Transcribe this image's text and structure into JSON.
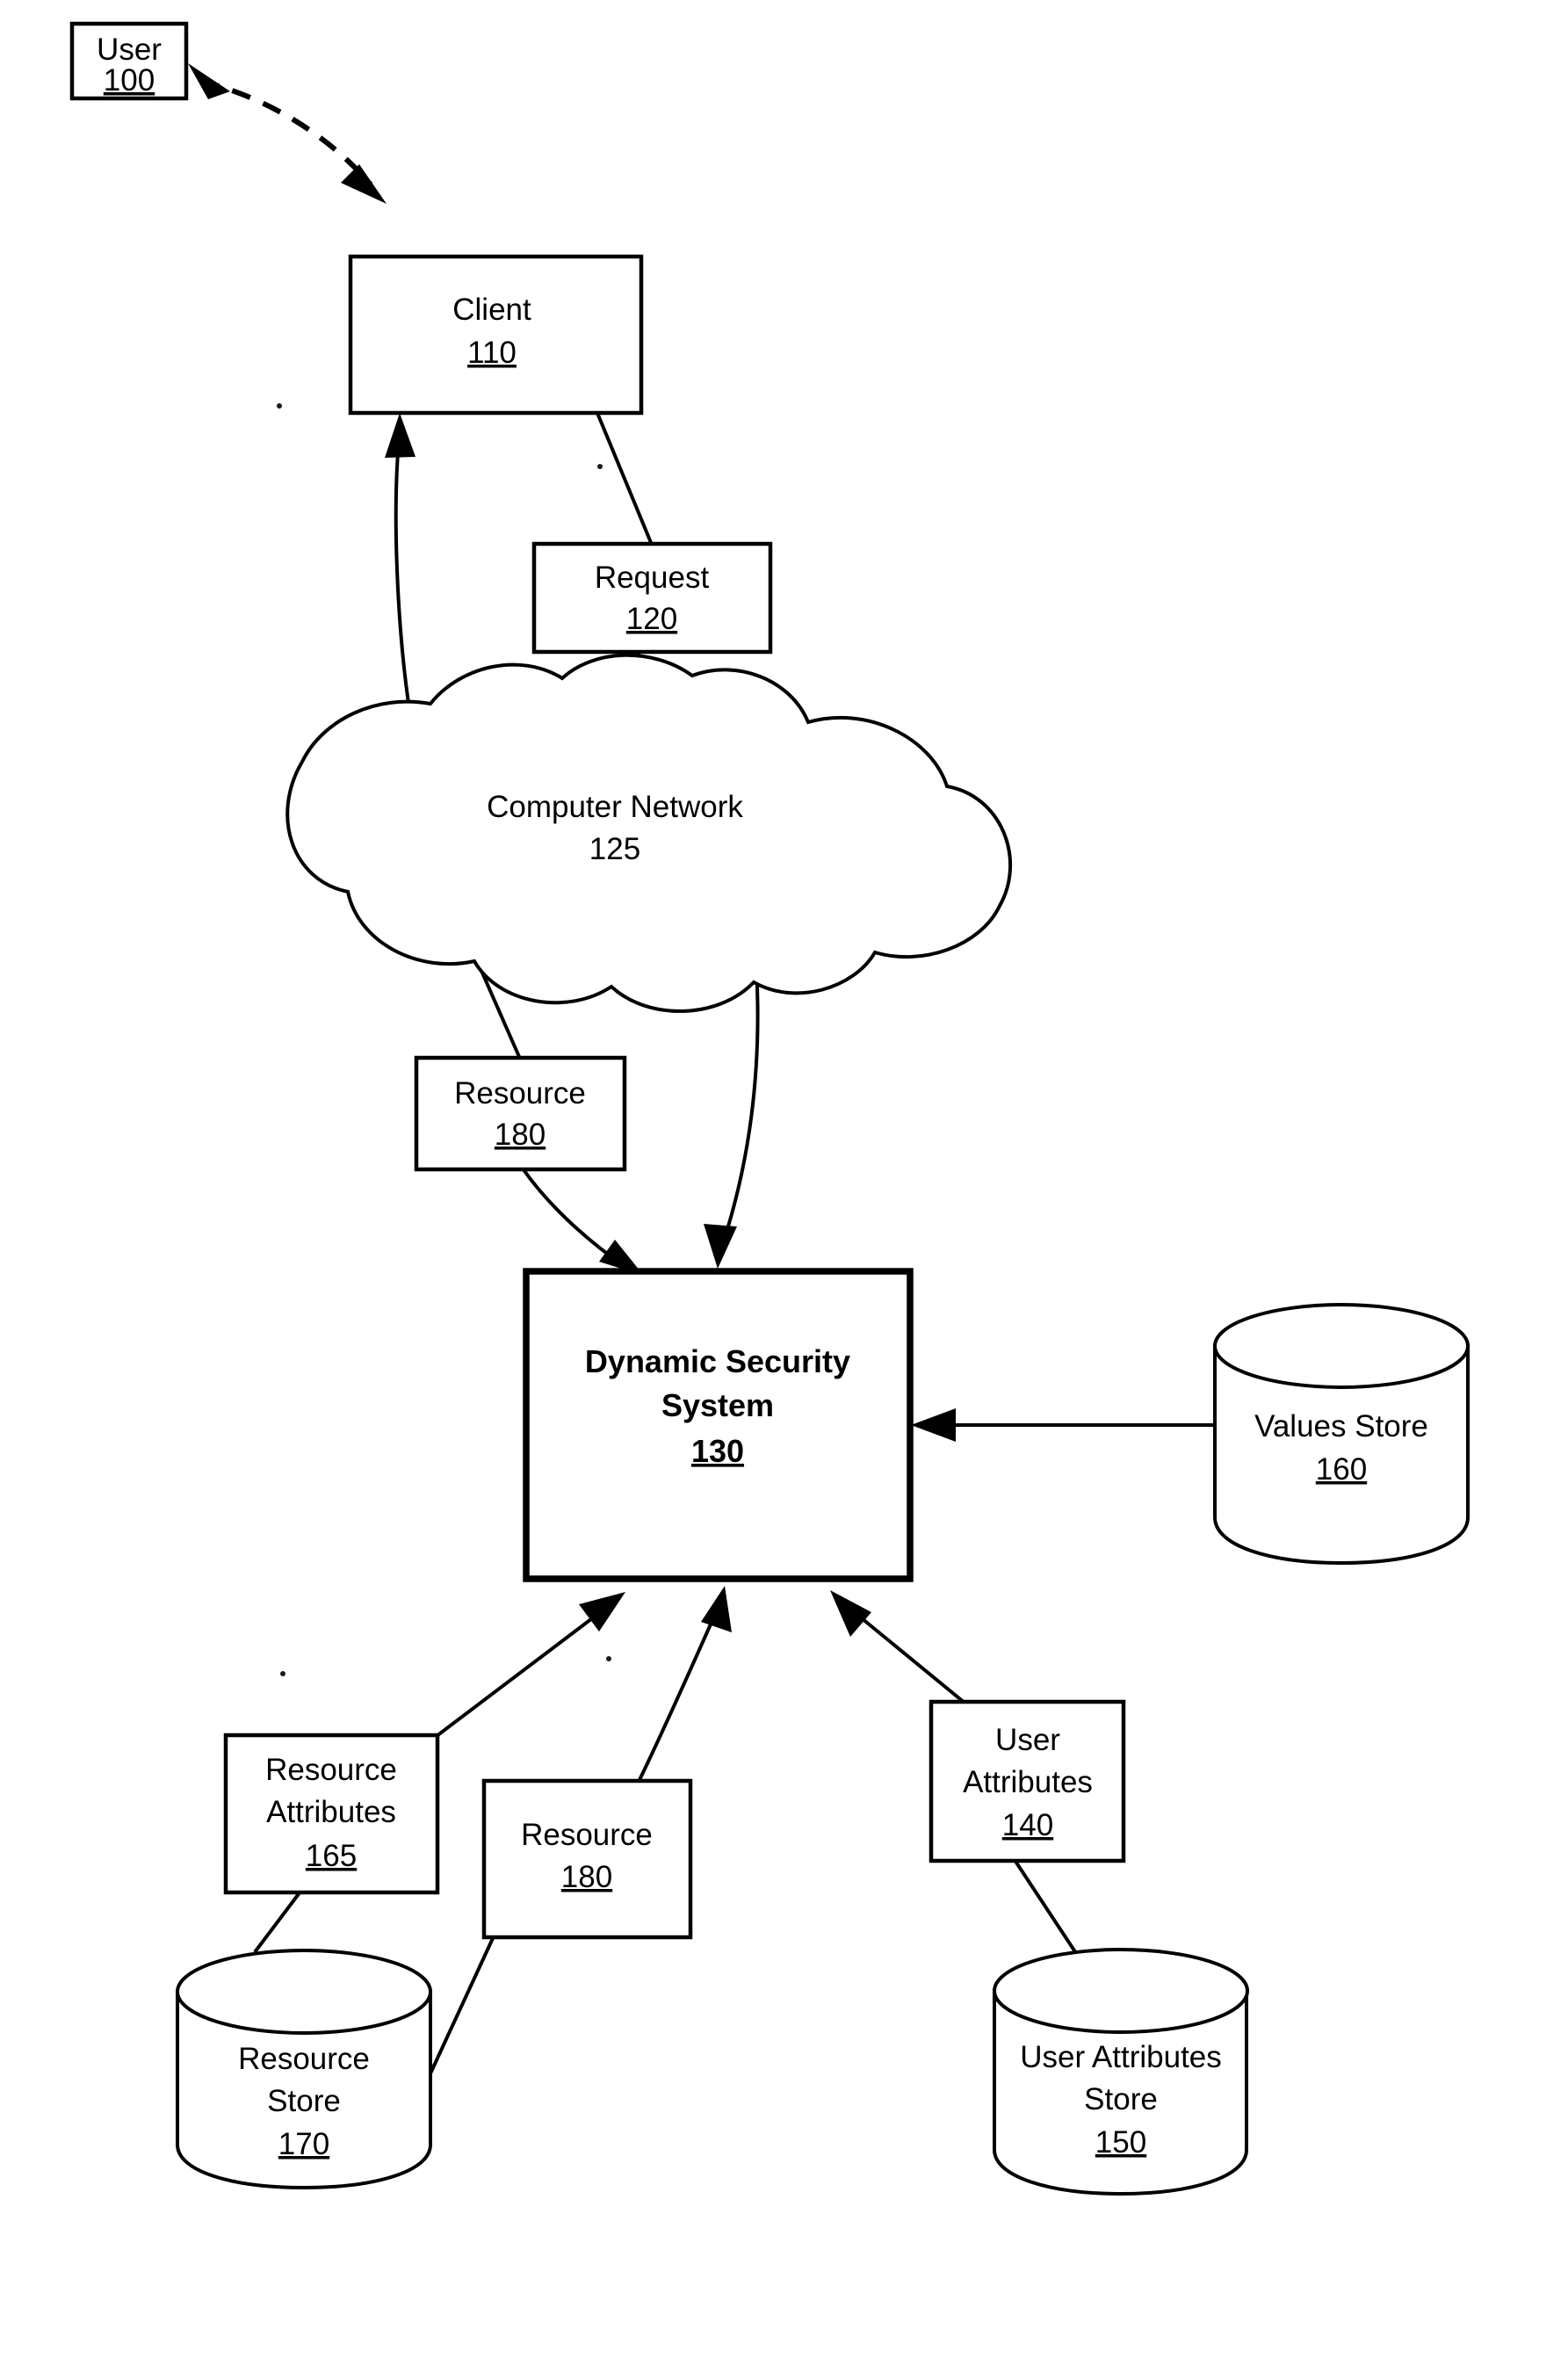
{
  "figure": {
    "type": "patent-block-diagram",
    "background_color": "#ffffff",
    "line_color": "#000000"
  },
  "nodes": {
    "user": {
      "label": "User",
      "ref": "100",
      "shape": "rectangle",
      "ref_underlined": true
    },
    "client": {
      "label": "Client",
      "ref": "110",
      "shape": "rectangle",
      "ref_underlined": true
    },
    "request": {
      "label": "Request",
      "ref": "120",
      "shape": "rectangle",
      "ref_underlined": true
    },
    "network": {
      "label": "Computer Network",
      "ref": "125",
      "shape": "cloud",
      "ref_underlined": false
    },
    "resource_upper": {
      "label": "Resource",
      "ref": "180",
      "shape": "rectangle",
      "ref_underlined": true
    },
    "dynamic_security_system": {
      "label_line1": "Dynamic Security",
      "label_line2": "System",
      "ref": "130",
      "shape": "rectangle",
      "bold": true,
      "ref_underlined": true
    },
    "values_store": {
      "label": "Values Store",
      "ref": "160",
      "shape": "cylinder",
      "ref_underlined": true
    },
    "resource_attributes": {
      "label_line1": "Resource",
      "label_line2": "Attributes",
      "ref": "165",
      "shape": "rectangle",
      "ref_underlined": true
    },
    "resource_lower": {
      "label": "Resource",
      "ref": "180",
      "shape": "rectangle",
      "ref_underlined": true
    },
    "user_attributes": {
      "label_line1": "User",
      "label_line2": "Attributes",
      "ref": "140",
      "shape": "rectangle",
      "ref_underlined": true
    },
    "resource_store": {
      "label_line1": "Resource",
      "label_line2": "Store",
      "ref": "170",
      "shape": "cylinder",
      "ref_underlined": true
    },
    "user_attributes_store": {
      "label_line1": "User Attributes",
      "label_line2": "Store",
      "ref": "150",
      "shape": "cylinder",
      "ref_underlined": true
    }
  },
  "connections": [
    {
      "from": "client",
      "to": "user",
      "style": "dashed",
      "arrows": "both"
    },
    {
      "from": "network",
      "to": "client",
      "style": "solid",
      "arrows": "to"
    },
    {
      "from": "client",
      "to": "request",
      "style": "solid",
      "arrows": "none"
    },
    {
      "from": "request",
      "to": "network",
      "style": "solid",
      "arrows": "none"
    },
    {
      "from": "network",
      "to": "resource_upper",
      "style": "solid",
      "arrows": "none"
    },
    {
      "from": "resource_upper",
      "to": "dynamic_security_system",
      "style": "solid",
      "arrows": "to"
    },
    {
      "from": "network",
      "to": "dynamic_security_system",
      "style": "solid",
      "arrows": "to"
    },
    {
      "from": "values_store",
      "to": "dynamic_security_system",
      "style": "solid",
      "arrows": "to"
    },
    {
      "from": "resource_attributes",
      "to": "dynamic_security_system",
      "style": "solid",
      "arrows": "to"
    },
    {
      "from": "resource_lower",
      "to": "dynamic_security_system",
      "style": "solid",
      "arrows": "to"
    },
    {
      "from": "user_attributes",
      "to": "dynamic_security_system",
      "style": "solid",
      "arrows": "to"
    },
    {
      "from": "resource_store",
      "to": "resource_attributes",
      "style": "solid",
      "arrows": "none"
    },
    {
      "from": "resource_store",
      "to": "resource_lower",
      "style": "solid",
      "arrows": "none"
    },
    {
      "from": "user_attributes_store",
      "to": "user_attributes",
      "style": "solid",
      "arrows": "none"
    }
  ]
}
